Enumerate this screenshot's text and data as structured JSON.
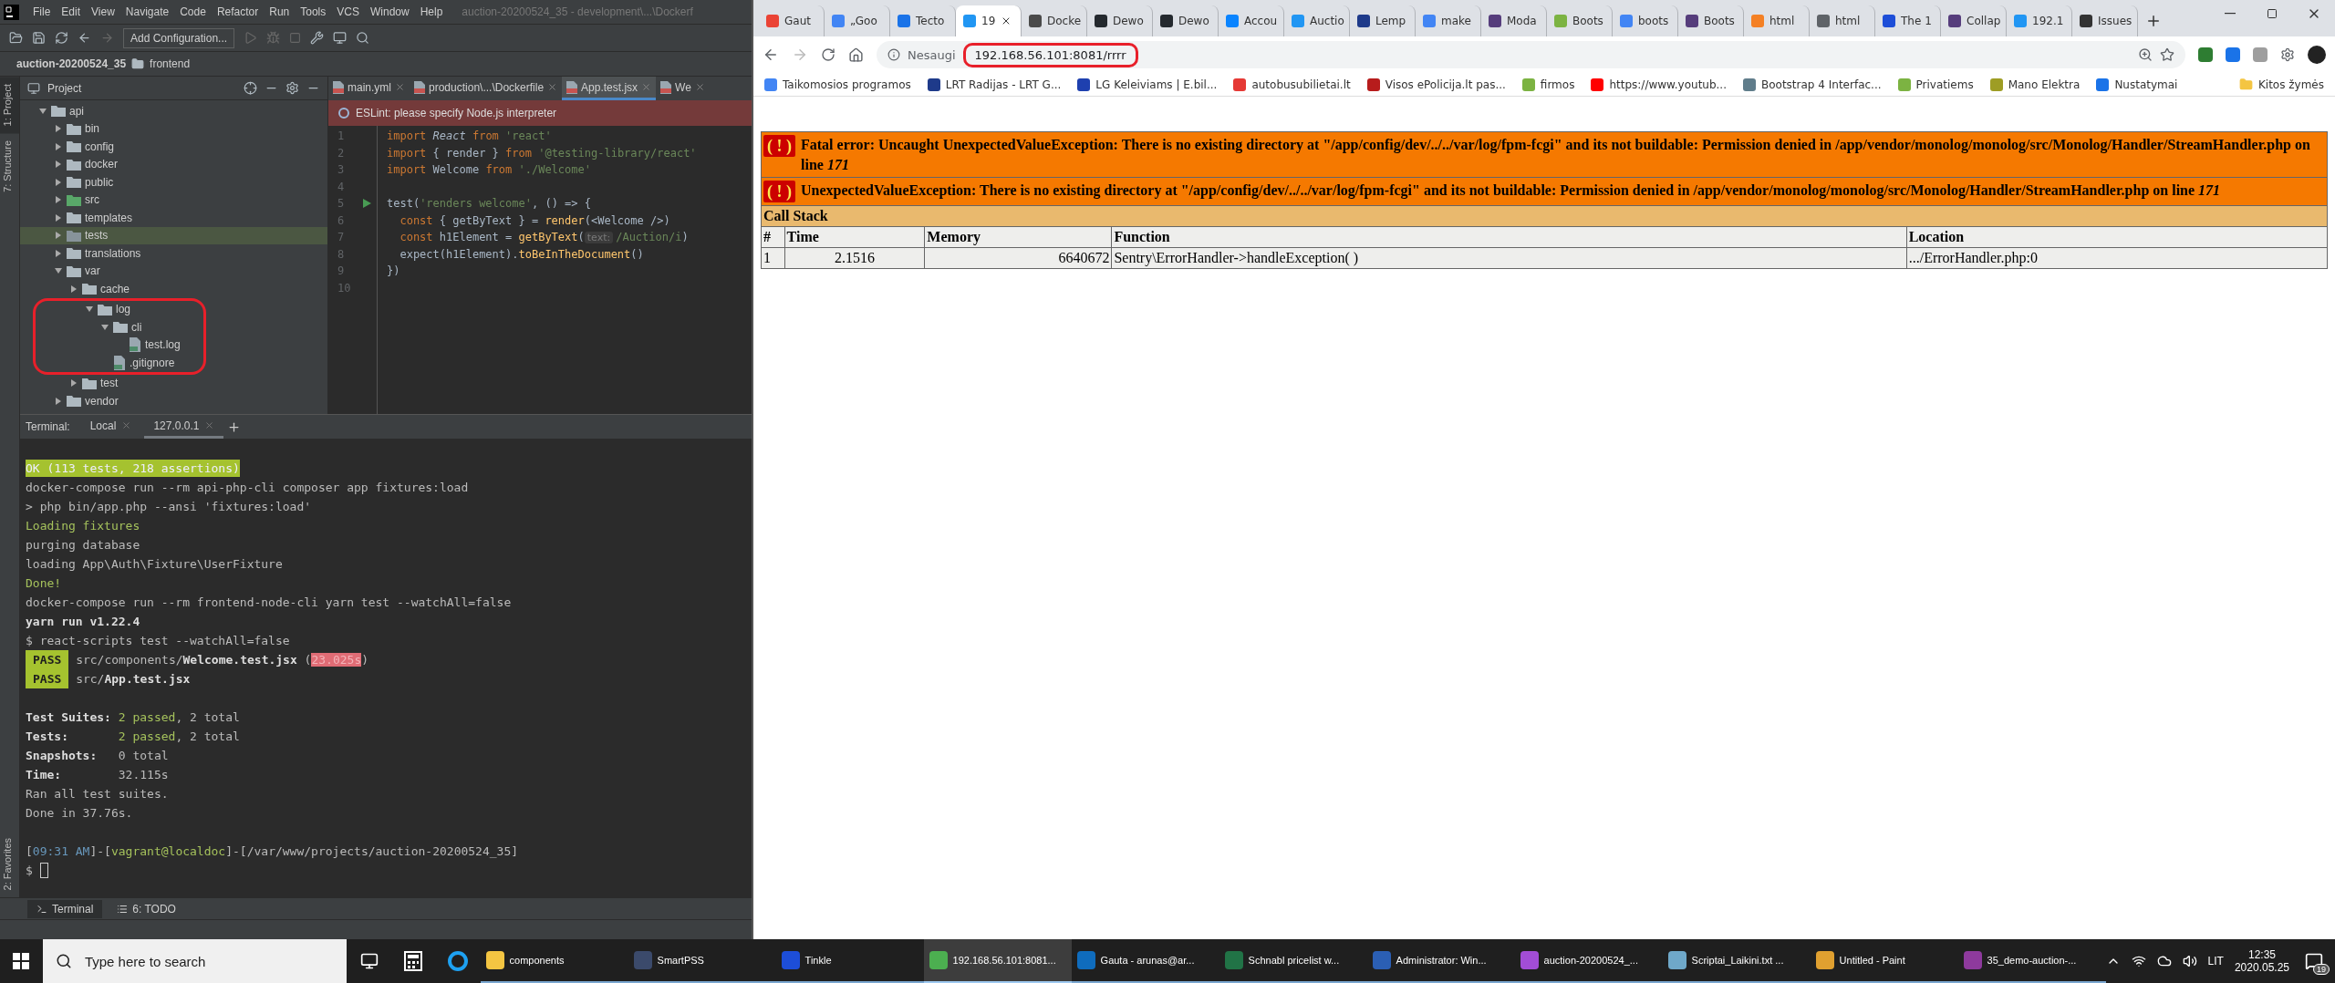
{
  "ide": {
    "menu": [
      "File",
      "Edit",
      "View",
      "Navigate",
      "Code",
      "Refactor",
      "Run",
      "Tools",
      "VCS",
      "Window",
      "Help"
    ],
    "title": "auction-20200524_35 - development\\...\\Dockerf",
    "run_config": "Add Configuration...",
    "breadcrumb": [
      "auction-20200524_35",
      "frontend"
    ],
    "side_tabs_top": [
      {
        "label": "1: Project",
        "selected": true
      },
      {
        "label": "7: Structure",
        "selected": false
      }
    ],
    "side_tabs_bottom": [
      {
        "label": "2: Favorites",
        "selected": false
      }
    ],
    "project_panel": {
      "title": "Project",
      "tree": [
        {
          "label": "api",
          "kind": "folder",
          "expanded": true,
          "selected": false,
          "circled": false,
          "children": [
            {
              "label": "bin",
              "kind": "folder",
              "expanded": false,
              "selected": false,
              "circled": false
            },
            {
              "label": "config",
              "kind": "folder",
              "expanded": false,
              "selected": false,
              "circled": false
            },
            {
              "label": "docker",
              "kind": "folder",
              "expanded": false,
              "selected": false,
              "circled": false
            },
            {
              "label": "public",
              "kind": "folder",
              "expanded": false,
              "selected": false,
              "circled": false
            },
            {
              "label": "src",
              "kind": "source",
              "expanded": false,
              "selected": false,
              "circled": false
            },
            {
              "label": "templates",
              "kind": "folder",
              "expanded": false,
              "selected": false,
              "circled": false
            },
            {
              "label": "tests",
              "kind": "folder",
              "expanded": false,
              "selected": true,
              "circled": false
            },
            {
              "label": "translations",
              "kind": "folder",
              "expanded": false,
              "selected": false,
              "circled": false
            },
            {
              "label": "var",
              "kind": "folder",
              "expanded": true,
              "selected": false,
              "circled": false,
              "children": [
                {
                  "label": "cache",
                  "kind": "folder",
                  "expanded": false,
                  "selected": false,
                  "circled": false
                },
                {
                  "label": "log",
                  "kind": "folder",
                  "expanded": true,
                  "selected": false,
                  "circled": true,
                  "children": [
                    {
                      "label": "cli",
                      "kind": "folder",
                      "expanded": true,
                      "selected": false,
                      "circled": false,
                      "children": [
                        {
                          "label": "test.log",
                          "kind": "file",
                          "selected": false,
                          "circled": false
                        }
                      ]
                    },
                    {
                      "label": ".gitignore",
                      "kind": "file",
                      "selected": false,
                      "circled": false
                    }
                  ]
                },
                {
                  "label": "test",
                  "kind": "folder",
                  "expanded": false,
                  "selected": false,
                  "circled": false
                }
              ]
            },
            {
              "label": "vendor",
              "kind": "folder",
              "expanded": false,
              "selected": false,
              "circled": false
            }
          ]
        }
      ]
    },
    "editor": {
      "tabs": [
        {
          "label": "main.yml",
          "selected": false
        },
        {
          "label": "production\\...\\Dockerfile",
          "selected": false
        },
        {
          "label": "App.test.jsx",
          "selected": true
        },
        {
          "label": "We",
          "selected": false
        }
      ],
      "banner": "ESLint: please specify Node.js interpreter",
      "lines": [
        {
          "number": "1",
          "run": false,
          "tokens": [
            {
              "kind": "kw",
              "text": "import "
            },
            {
              "kind": "italic",
              "text": "React"
            },
            {
              "kind": "kw",
              "text": " from "
            },
            {
              "kind": "str",
              "text": "'react'"
            }
          ]
        },
        {
          "number": "2",
          "run": false,
          "tokens": [
            {
              "kind": "kw",
              "text": "import "
            },
            {
              "kind": "plain",
              "text": "{ render } "
            },
            {
              "kind": "kw",
              "text": "from "
            },
            {
              "kind": "str",
              "text": "'@testing-library/react'"
            }
          ]
        },
        {
          "number": "3",
          "run": false,
          "tokens": [
            {
              "kind": "kw",
              "text": "import "
            },
            {
              "kind": "plain",
              "text": "Welcome "
            },
            {
              "kind": "kw",
              "text": "from "
            },
            {
              "kind": "str",
              "text": "'./Welcome'"
            }
          ]
        },
        {
          "number": "4",
          "run": false
        },
        {
          "number": "5",
          "run": true,
          "tokens": [
            {
              "kind": "plain",
              "text": "test("
            },
            {
              "kind": "str",
              "text": "'renders welcome'"
            },
            {
              "kind": "plain",
              "text": ", () => {"
            }
          ]
        },
        {
          "number": "6",
          "run": false,
          "tokens": [
            {
              "kind": "kw",
              "text": "  const "
            },
            {
              "kind": "plain",
              "text": "{ getByText } = "
            },
            {
              "kind": "fn",
              "text": "render"
            },
            {
              "kind": "plain",
              "text": "(<Welcome />)"
            }
          ]
        },
        {
          "number": "7",
          "run": false,
          "tokens": [
            {
              "kind": "kw",
              "text": "  const "
            },
            {
              "kind": "plain",
              "text": "h1Element = "
            },
            {
              "kind": "fn",
              "text": "getByText"
            },
            {
              "kind": "plain",
              "text": "("
            },
            {
              "kind": "hint",
              "text": "text:"
            },
            {
              "kind": "str",
              "text": "/Auction/i"
            },
            {
              "kind": "plain",
              "text": ")"
            }
          ]
        },
        {
          "number": "8",
          "run": false,
          "tokens": [
            {
              "kind": "plain",
              "text": "  expect(h1Element)."
            },
            {
              "kind": "fn",
              "text": "toBeInTheDocument"
            },
            {
              "kind": "plain",
              "text": "()"
            }
          ]
        },
        {
          "number": "9",
          "run": false,
          "tokens": [
            {
              "kind": "plain",
              "text": "})"
            }
          ]
        },
        {
          "number": "10",
          "run": false
        }
      ]
    },
    "terminal": {
      "label": "Terminal:",
      "tabs": [
        {
          "label": "Local",
          "selected": false
        },
        {
          "label": "127.0.0.1",
          "selected": true
        }
      ],
      "cursor": true,
      "blocks": [
        [
          [
            {
              "kind": "okbar",
              "text": "OK (113 tests, 218 assertions)"
            }
          ],
          [
            {
              "kind": "plain",
              "text": "docker-compose run --rm api-php-cli composer app fixtures:load"
            }
          ],
          [
            {
              "kind": "plain",
              "text": "> php bin/app.php --ansi 'fixtures:load'"
            }
          ],
          [
            {
              "kind": "green",
              "text": "Loading fixtures"
            }
          ],
          [
            {
              "kind": "plain",
              "text": "purging database"
            }
          ],
          [
            {
              "kind": "plain",
              "text": "loading App\\Auth\\Fixture\\UserFixture"
            }
          ],
          [
            {
              "kind": "green",
              "text": "Done!"
            }
          ],
          [
            {
              "kind": "plain",
              "text": "docker-compose run --rm frontend-node-cli yarn test --watchAll=false"
            }
          ],
          [
            {
              "kind": "bold",
              "text": "yarn run v1.22.4"
            }
          ],
          [
            {
              "kind": "plain",
              "text": "$ react-scripts test --watchAll=false"
            }
          ],
          [
            {
              "kind": "badge",
              "text": "PASS"
            },
            {
              "kind": "plain",
              "text": " src/components/"
            },
            {
              "kind": "bold",
              "text": "Welcome.test.jsx"
            },
            {
              "kind": "plain",
              "text": " ("
            },
            {
              "kind": "red",
              "text": "23.025s"
            },
            {
              "kind": "plain",
              "text": ")"
            }
          ],
          [
            {
              "kind": "badge",
              "text": "PASS"
            },
            {
              "kind": "plain",
              "text": " src/"
            },
            {
              "kind": "bold",
              "text": "App.test.jsx"
            }
          ]
        ],
        [
          [
            {
              "kind": "bold",
              "text": "Test Suites: "
            },
            {
              "kind": "green",
              "text": "2 passed"
            },
            {
              "kind": "plain",
              "text": ", 2 total"
            }
          ],
          [
            {
              "kind": "bold",
              "text": "Tests:       "
            },
            {
              "kind": "green",
              "text": "2 passed"
            },
            {
              "kind": "plain",
              "text": ", 2 total"
            }
          ],
          [
            {
              "kind": "bold",
              "text": "Snapshots:   "
            },
            {
              "kind": "plain",
              "text": "0 total"
            }
          ],
          [
            {
              "kind": "bold",
              "text": "Time:        "
            },
            {
              "kind": "plain",
              "text": "32.115s"
            }
          ],
          [
            {
              "kind": "plain",
              "text": "Ran all test suites."
            }
          ],
          [
            {
              "kind": "plain",
              "text": "Done in 37.76s."
            }
          ]
        ],
        [
          [
            {
              "kind": "plain",
              "text": "["
            },
            {
              "kind": "blue",
              "text": "09:31 AM"
            },
            {
              "kind": "plain",
              "text": "]-["
            },
            {
              "kind": "green",
              "text": "vagrant@localdoc"
            },
            {
              "kind": "plain",
              "text": "]-["
            },
            {
              "kind": "plain",
              "text": "/var/www/projects/auction-20200524_35"
            },
            {
              "kind": "plain",
              "text": "]"
            }
          ],
          [
            {
              "kind": "plain",
              "text": "$"
            }
          ]
        ]
      ]
    },
    "bottom_tabs": [
      {
        "label": "Terminal",
        "selected": true
      },
      {
        "label": "6: TODO",
        "selected": false
      }
    ]
  },
  "browser": {
    "tabs": [
      {
        "label": "Gaut",
        "selected": false,
        "color": "#ea4335"
      },
      {
        "label": "„Goo",
        "selected": false,
        "color": "#4285f4"
      },
      {
        "label": "Tecto",
        "selected": false,
        "color": "#1a73e8"
      },
      {
        "label": "19",
        "selected": true,
        "color": "#2196f3"
      },
      {
        "label": "Docke",
        "selected": false,
        "color": "#4a4a4a"
      },
      {
        "label": "Dewo",
        "selected": false,
        "color": "#24292e"
      },
      {
        "label": "Dewo",
        "selected": false,
        "color": "#24292e"
      },
      {
        "label": "Accou",
        "selected": false,
        "color": "#0a84ff"
      },
      {
        "label": "Auctio",
        "selected": false,
        "color": "#2196f3"
      },
      {
        "label": "Lemp",
        "selected": false,
        "color": "#1e3a8a"
      },
      {
        "label": "make",
        "selected": false,
        "color": "#4285f4"
      },
      {
        "label": "Moda",
        "selected": false,
        "color": "#563d7c"
      },
      {
        "label": "Boots",
        "selected": false,
        "color": "#7cb342"
      },
      {
        "label": "boots",
        "selected": false,
        "color": "#4285f4"
      },
      {
        "label": "Boots",
        "selected": false,
        "color": "#563d7c"
      },
      {
        "label": "html",
        "selected": false,
        "color": "#f48024"
      },
      {
        "label": "html",
        "selected": false,
        "color": "#5f6368"
      },
      {
        "label": "The 1",
        "selected": false,
        "color": "#1d4ed8"
      },
      {
        "label": "Collap",
        "selected": false,
        "color": "#563d7c"
      },
      {
        "label": "192.1",
        "selected": false,
        "color": "#2196f3"
      },
      {
        "label": "Issues",
        "selected": false,
        "color": "#333333"
      }
    ],
    "address": {
      "security": "Nesaugi",
      "url": "192.168.56.101:8081/rrrr",
      "circled": true
    },
    "bookmarks": [
      {
        "label": "Taikomosios programos",
        "color": "#4285f4"
      },
      {
        "label": "LRT Radijas - LRT G...",
        "color": "#1e3a8a"
      },
      {
        "label": "LG Keleiviams | E.bil...",
        "color": "#1e40af"
      },
      {
        "label": "autobusubilietai.lt",
        "color": "#e53935"
      },
      {
        "label": "Visos ePolicija.lt pas...",
        "color": "#b71c1c"
      },
      {
        "label": "firmos",
        "color": "#7cb342"
      },
      {
        "label": "https://www.youtub...",
        "color": "#ff0000"
      },
      {
        "label": "Bootstrap 4 Interfac...",
        "color": "#607d8b"
      },
      {
        "label": "Privatiems",
        "color": "#7cb342"
      },
      {
        "label": "Mano Elektra",
        "color": "#9e9d24"
      },
      {
        "label": "Nustatymai",
        "color": "#1a73e8"
      }
    ],
    "other_bookmarks": "Kitos žymės",
    "error": {
      "badge": "( ! )",
      "messages": [
        "Fatal error: Uncaught UnexpectedValueException: There is no existing directory at \"/app/config/dev/../../var/log/fpm-fcgi\" and its not buildable: Permission denied in /app/vendor/monolog/monolog/src/Monolog/Handler/StreamHandler.php on line *171*",
        "UnexpectedValueException: There is no existing directory at \"/app/config/dev/../../var/log/fpm-fcgi\" and its not buildable: Permission denied in /app/vendor/monolog/monolog/src/Monolog/Handler/StreamHandler.php on line *171*"
      ],
      "stack_title": "Call Stack",
      "columns": [
        "#",
        "Time",
        "Memory",
        "Function",
        "Location"
      ],
      "rows": [
        [
          "1",
          "2.1516",
          "6640672",
          "Sentry\\ErrorHandler->handleException( )",
          ".../ErrorHandler.php:0"
        ]
      ]
    }
  },
  "taskbar": {
    "search": {
      "placeholder": "Type here to search"
    },
    "items": [
      {
        "kind": "pinned",
        "selected": false
      },
      {
        "kind": "pinned",
        "selected": false
      },
      {
        "kind": "pinned",
        "selected": false
      },
      {
        "kind": "window",
        "label": "components",
        "color": "#f4c542",
        "selected": false
      },
      {
        "kind": "window",
        "label": "SmartPSS",
        "color": "#3b4a6b",
        "selected": false
      },
      {
        "kind": "window",
        "label": "Tinkle",
        "color": "#1d4ed8",
        "selected": false
      },
      {
        "kind": "window",
        "label": "192.168.56.101:8081...",
        "color": "#4caf50",
        "selected": true
      },
      {
        "kind": "window",
        "label": "Gauta - arunas@ar...",
        "color": "#0f6cbd",
        "selected": false
      },
      {
        "kind": "window",
        "label": "Schnabl pricelist w...",
        "color": "#217346",
        "selected": false
      },
      {
        "kind": "window",
        "label": "Administrator: Win...",
        "color": "#2b5fb4",
        "selected": false
      },
      {
        "kind": "window",
        "label": "auction-20200524_...",
        "color": "#a24dd6",
        "selected": false
      },
      {
        "kind": "window",
        "label": "Scriptai_Laikini.txt ...",
        "color": "#6fa8c9",
        "selected": false
      },
      {
        "kind": "window",
        "label": "Untitled - Paint",
        "color": "#e0a030",
        "selected": false
      },
      {
        "kind": "window",
        "label": "35_demo-auction-...",
        "color": "#8e3a9d",
        "selected": false
      }
    ],
    "language": "LIT",
    "time": "12:35",
    "date": "2020.05.25",
    "notifications": "19"
  }
}
